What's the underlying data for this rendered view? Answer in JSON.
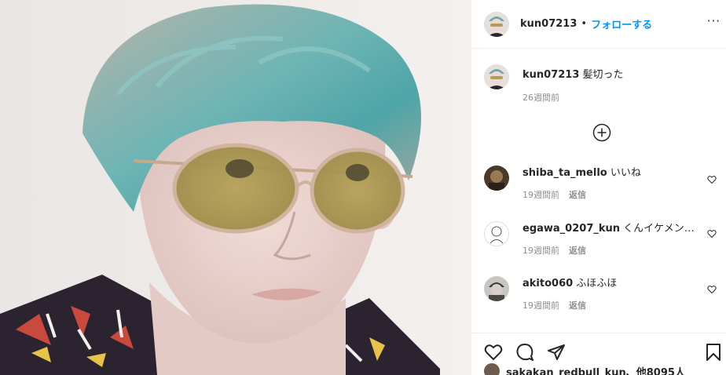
{
  "post": {
    "username": "kun07213",
    "dot": "•",
    "follow_label": "フォローする",
    "more_label": "···"
  },
  "caption": {
    "username": "kun07213",
    "text": "髪切った",
    "time": "26週間前"
  },
  "comments": [
    {
      "username": "shiba_ta_mello",
      "text": "いいね",
      "time": "19週間前",
      "reply": "返信"
    },
    {
      "username": "egawa_0207_kun",
      "text": "くんイケメン…",
      "time": "19週間前",
      "reply": "返信"
    },
    {
      "username": "akito060",
      "text": "ふほふほ",
      "time": "19週間前",
      "reply": "返信"
    }
  ],
  "likes": {
    "text": "sakakan_redbull_kun、他8095人"
  },
  "icons": [
    "more-icon",
    "load-more-icon",
    "heart-icon",
    "comment-icon",
    "share-icon",
    "bookmark-icon"
  ],
  "colors": {
    "accent": "#0095f6",
    "text": "#262626",
    "muted": "#8e8e8e",
    "border": "#efefef"
  }
}
